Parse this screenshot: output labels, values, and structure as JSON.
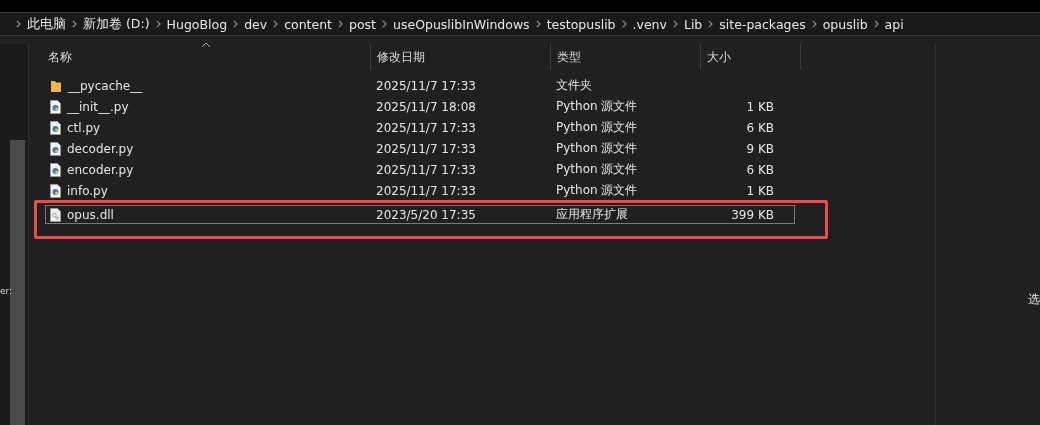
{
  "breadcrumb": [
    "此电脑",
    "新加卷 (D:)",
    "HugoBlog",
    "dev",
    "content",
    "post",
    "useOpuslibInWindows",
    "testopuslib",
    ".venv",
    "Lib",
    "site-packages",
    "opuslib",
    "api"
  ],
  "nav_pane": {
    "fragment": "er:"
  },
  "columns": [
    "名称",
    "修改日期",
    "类型",
    "大小"
  ],
  "rows": [
    {
      "name": "__pycache__",
      "modified": "2025/11/7 17:33",
      "type": "文件夹",
      "size": "",
      "kind": "folder",
      "selected": false,
      "annotated": false
    },
    {
      "name": "__init__.py",
      "modified": "2025/11/7 18:08",
      "type": "Python 源文件",
      "size": "1 KB",
      "kind": "python",
      "selected": false,
      "annotated": false
    },
    {
      "name": "ctl.py",
      "modified": "2025/11/7 17:33",
      "type": "Python 源文件",
      "size": "6 KB",
      "kind": "python",
      "selected": false,
      "annotated": false
    },
    {
      "name": "decoder.py",
      "modified": "2025/11/7 17:33",
      "type": "Python 源文件",
      "size": "9 KB",
      "kind": "python",
      "selected": false,
      "annotated": false
    },
    {
      "name": "encoder.py",
      "modified": "2025/11/7 17:33",
      "type": "Python 源文件",
      "size": "6 KB",
      "kind": "python",
      "selected": false,
      "annotated": false
    },
    {
      "name": "info.py",
      "modified": "2025/11/7 17:33",
      "type": "Python 源文件",
      "size": "1 KB",
      "kind": "python",
      "selected": false,
      "annotated": false
    },
    {
      "name": "opus.dll",
      "modified": "2023/5/20 17:35",
      "type": "应用程序扩展",
      "size": "399 KB",
      "kind": "dll",
      "selected": true,
      "annotated": true
    }
  ],
  "details_pane": {
    "text": "选"
  }
}
